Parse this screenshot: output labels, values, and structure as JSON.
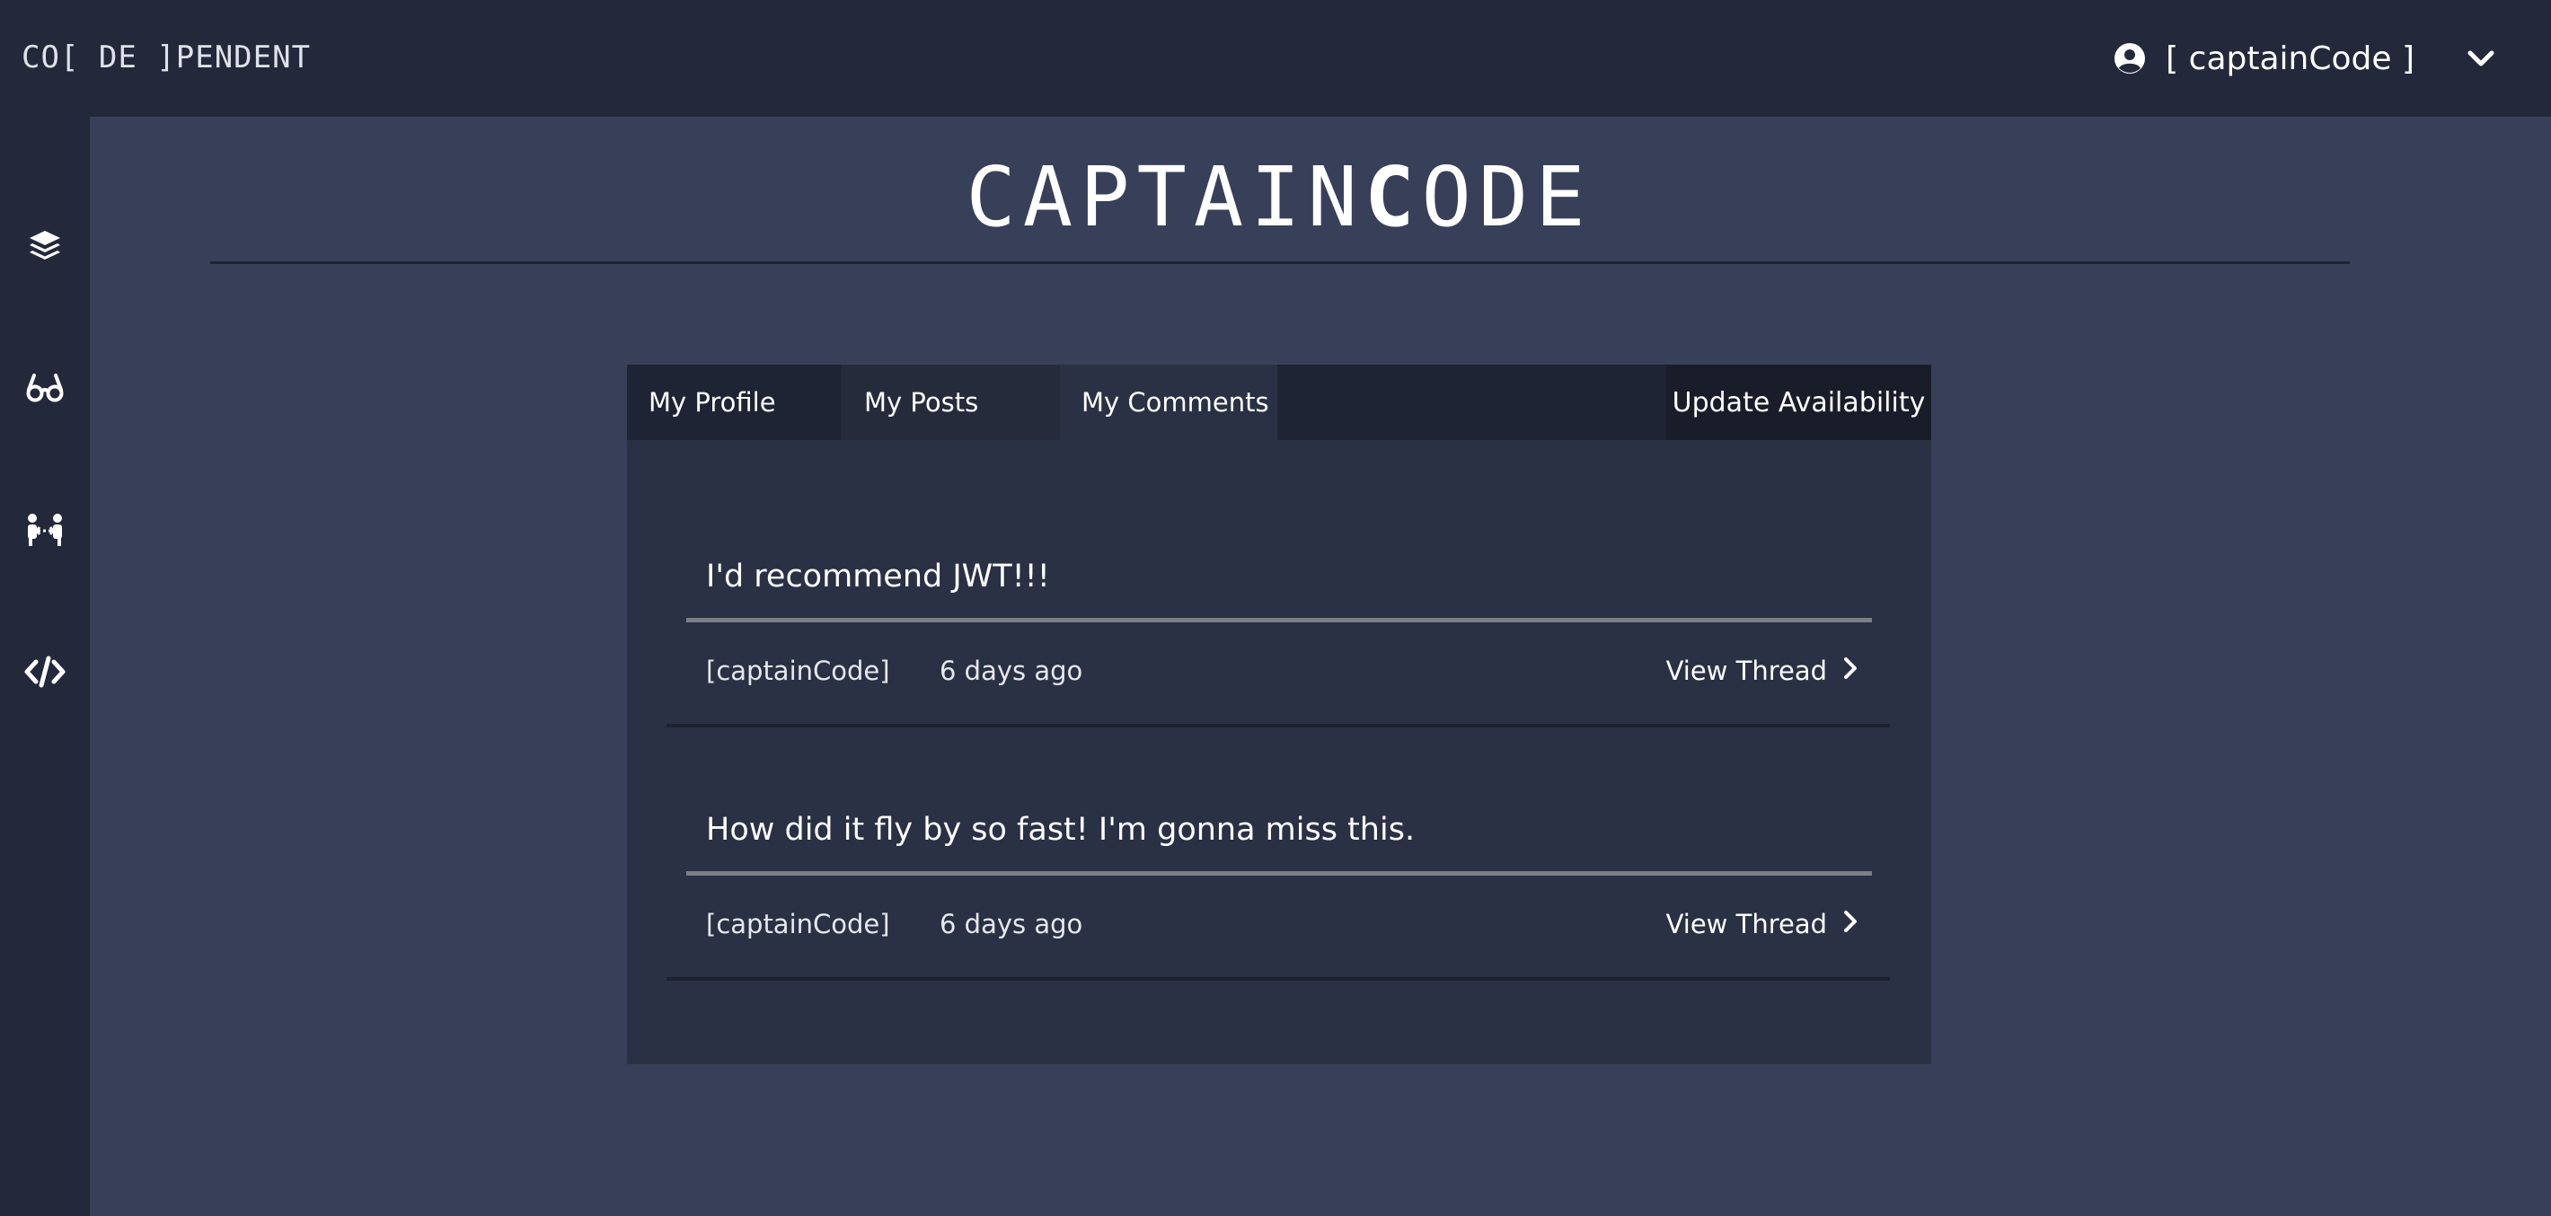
{
  "header": {
    "brand": "CO[ DE ]PENDENT",
    "user_label": "[ captainCode ]"
  },
  "sidebar": {
    "items": [
      {
        "icon": "layers-icon"
      },
      {
        "icon": "glasses-icon"
      },
      {
        "icon": "people-connect-icon"
      },
      {
        "icon": "code-icon"
      }
    ]
  },
  "page": {
    "title_part1": "CAPTAIN",
    "title_bold": "C",
    "title_part2": "ODE"
  },
  "tabs": {
    "profile": "My Profile",
    "posts": "My Posts",
    "comments": "My Comments",
    "update_availability": "Update Availability"
  },
  "comments": [
    {
      "text": "I'd recommend JWT!!!",
      "author": "[captainCode]",
      "time": "6 days ago",
      "link": "View Thread"
    },
    {
      "text": "How did it fly by so fast! I'm gonna miss this.",
      "author": "[captainCode]",
      "time": "6 days ago",
      "link": "View Thread"
    }
  ],
  "colors": {
    "background": "#384059",
    "topbar": "#23283a",
    "panel": "#2a3145",
    "tab_bar": "#1f2434",
    "button_dark": "#191d2a"
  }
}
